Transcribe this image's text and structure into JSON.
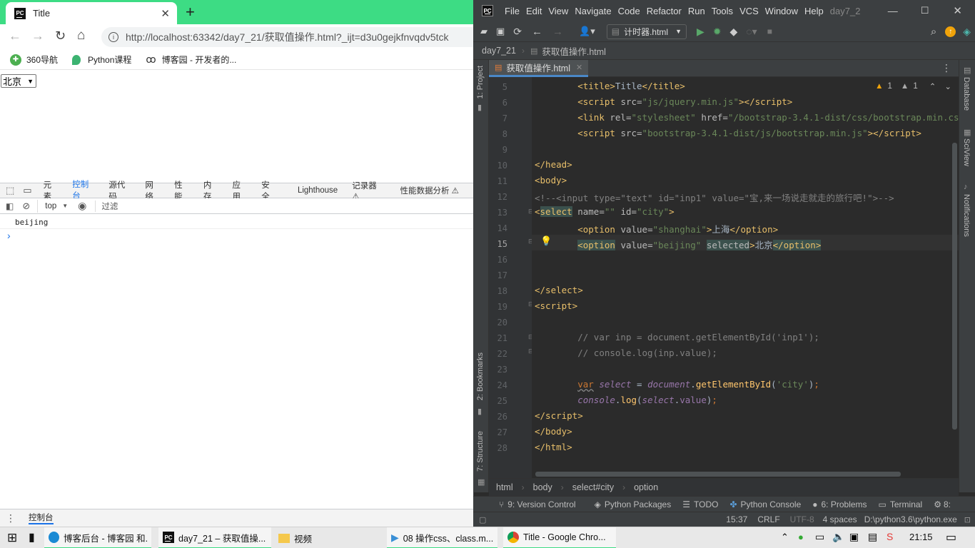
{
  "browser": {
    "tab_title": "Title",
    "url": "http://localhost:63342/day7_21/获取值操作.html?_ijt=d3u0gejkfnvqdv5tck",
    "bookmarks": [
      "360导航",
      "Python课程",
      "博客园 - 开发者的..."
    ],
    "page": {
      "select_value": "北京"
    },
    "devtools": {
      "tabs": [
        "元素",
        "控制台",
        "源代码",
        "网络",
        "性能",
        "内存",
        "应用",
        "安全",
        "Lighthouse",
        "记录器 ⚠",
        "性能数据分析 ⚠"
      ],
      "active_tab": "控制台",
      "context": "top",
      "filter_placeholder": "过滤",
      "console_output": "beijing",
      "prompt": "›",
      "drawer_tab": "控制台"
    }
  },
  "ide": {
    "menu": [
      "File",
      "Edit",
      "View",
      "Navigate",
      "Code",
      "Refactor",
      "Run",
      "Tools",
      "VCS",
      "Window",
      "Help",
      "day7_2"
    ],
    "run_config": "计时器.html",
    "nav_project": "day7_21",
    "nav_file": "获取值操作.html",
    "file_tab": "获取值操作.html",
    "left_tools": [
      "1: Project",
      "2: Bookmarks",
      "7: Structure"
    ],
    "right_tools": [
      "Database",
      "SciView",
      "Notifications"
    ],
    "inspections": {
      "warnings": "1",
      "weak": "1"
    },
    "line_numbers": [
      "5",
      "6",
      "7",
      "8",
      "9",
      "10",
      "11",
      "12",
      "13",
      "14",
      "15",
      "16",
      "17",
      "18",
      "19",
      "20",
      "21",
      "22",
      "23",
      "24",
      "25",
      "26",
      "27",
      "28"
    ],
    "breadcrumb": [
      "html",
      "body",
      "select#city",
      "option"
    ],
    "tool_windows": [
      "9: Version Control",
      "Python Packages",
      "TODO",
      "Python Console",
      "6: Problems",
      "Terminal",
      "8:"
    ],
    "status": {
      "position": "15:37",
      "line_sep": "CRLF",
      "encoding": "UTF-8",
      "indent": "4 spaces",
      "interpreter": "D:\\python3.6\\python.exe"
    }
  },
  "taskbar": {
    "items": [
      "博客后台 - 博客园 和...",
      "day7_21 – 获取值操...",
      "视频",
      "08 操作css、class.m...",
      "Title - Google Chro..."
    ],
    "clock": "21:15"
  }
}
